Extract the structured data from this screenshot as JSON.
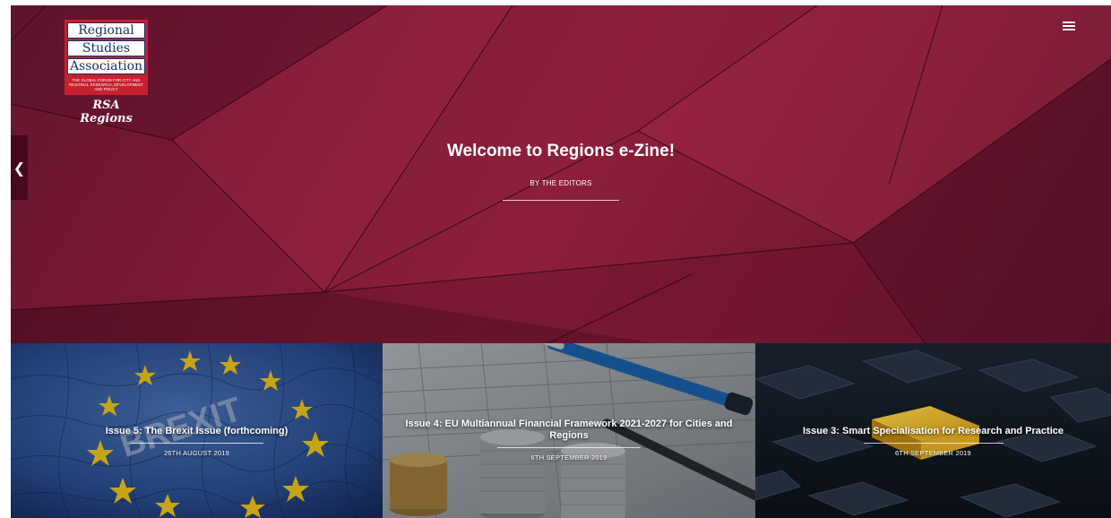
{
  "logo": {
    "line1": "Regional",
    "line2": "Studies",
    "line3": "Association",
    "tagline": "THE GLOBAL FORUM FOR CITY AND REGIONAL RESEARCH, DEVELOPMENT AND POLICY",
    "sub": "RSA Regions"
  },
  "nav": {
    "menu_icon": "hamburger-menu-icon",
    "prev_icon": "‹"
  },
  "hero": {
    "title": "Welcome to Regions e-Zine!",
    "author": "BY THE EDITORS"
  },
  "issues": [
    {
      "title": "Issue 5: The Brexit Issue (forthcoming)",
      "date": "26TH AUGUST 2019"
    },
    {
      "title": "Issue 4: EU Multiannual Financial Framework 2021-2027 for Cities and Regions",
      "date": "6TH SEPTEMBER 2019"
    },
    {
      "title": "Issue 3: Smart Specialisation for Research and Practice",
      "date": "6TH SEPTEMBER 2019"
    }
  ],
  "colors": {
    "hero_bg": "#7a1a34",
    "logo_red": "#c8202d",
    "logo_blue": "#1a2f6e",
    "eu_blue": "#1f4e9c",
    "eu_star": "#f2c81c"
  }
}
